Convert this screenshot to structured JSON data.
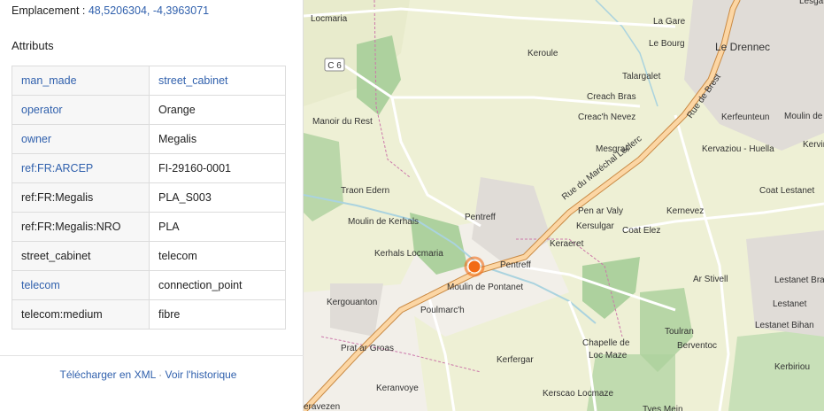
{
  "location": {
    "label": "Emplacement :",
    "coords": "48,5206304, -4,3963071"
  },
  "attributes": {
    "title": "Attributs",
    "rows": [
      {
        "key": "man_made",
        "value": "street_cabinet",
        "key_link": true,
        "value_link": true
      },
      {
        "key": "operator",
        "value": "Orange",
        "key_link": true,
        "value_link": false
      },
      {
        "key": "owner",
        "value": "Megalis",
        "key_link": true,
        "value_link": false
      },
      {
        "key": "ref:FR:ARCEP",
        "value": "FI-29160-0001",
        "key_link": true,
        "value_link": false
      },
      {
        "key": "ref:FR:Megalis",
        "value": "PLA_S003",
        "key_link": false,
        "value_link": false
      },
      {
        "key": "ref:FR:Megalis:NRO",
        "value": "PLA",
        "key_link": false,
        "value_link": false
      },
      {
        "key": "street_cabinet",
        "value": "telecom",
        "key_link": false,
        "value_link": false
      },
      {
        "key": "telecom",
        "value": "connection_point",
        "key_link": true,
        "value_link": false
      },
      {
        "key": "telecom:medium",
        "value": "fibre",
        "key_link": false,
        "value_link": false
      }
    ]
  },
  "footer": {
    "download": "Télécharger en XML",
    "separator": "·",
    "history": "Voir l'historique"
  },
  "map": {
    "road_shield": "C 6",
    "road_name": "Rue du Maréchal Leclerc",
    "road_name_2": "Rue de Brest",
    "town": "Le Drennec",
    "places": [
      "Locmaria",
      "La Gare",
      "Le Bourg",
      "Keroule",
      "Talargalet",
      "Creach Bras",
      "Manoir du Rest",
      "Creac'h Nevez",
      "Kerfeunteun",
      "Moulin de",
      "Mesgrall",
      "Kervaziou - Huella",
      "Kervin",
      "Traon Edern",
      "Coat Lestanet",
      "Moulin de Kerhals",
      "Pentreff",
      "Pen ar Valy",
      "Kernevez",
      "Kersulgar",
      "Coat Elez",
      "Keraeret",
      "Kerhals Locmaria",
      "Pentreff",
      "Moulin de Pontanet",
      "Ar Stivell",
      "Lestanet Braz",
      "Kergouanton",
      "Poulmarc'h",
      "Lestanet",
      "Lestanet Bihan",
      "Prat ar Groas",
      "Toulran",
      "Berventoc",
      "Chapelle de",
      "Loc Maze",
      "Kerfergar",
      "Kerbiriou",
      "Keranvoye",
      "Kerscao Locmaze",
      "Tyes Mein",
      "eravezen",
      "Lesgar"
    ],
    "colors": {
      "marker": "#f26b16",
      "road": "#f3a45c",
      "forest": "#add19e",
      "water": "#aad3df"
    }
  }
}
